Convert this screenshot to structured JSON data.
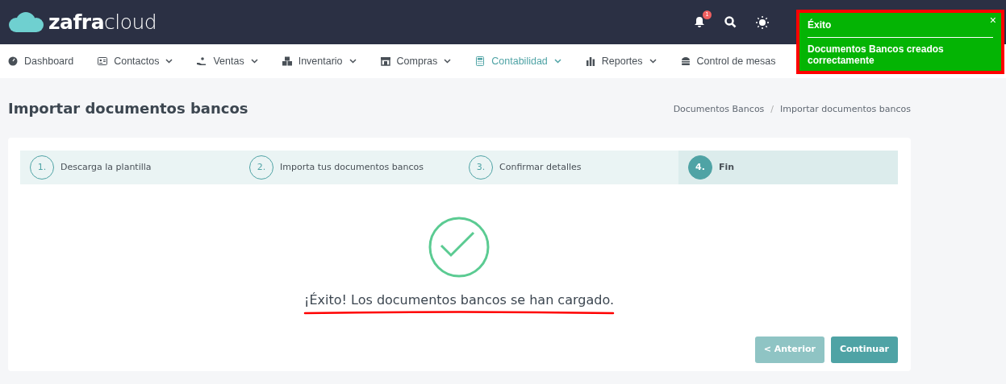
{
  "logo": {
    "brand_bold": "zafra",
    "brand_light": "cloud"
  },
  "header": {
    "notification_count": "1"
  },
  "nav": [
    {
      "label": "Dashboard",
      "has_dropdown": false,
      "selected": false
    },
    {
      "label": "Contactos",
      "has_dropdown": true,
      "selected": false
    },
    {
      "label": "Ventas",
      "has_dropdown": true,
      "selected": false
    },
    {
      "label": "Inventario",
      "has_dropdown": true,
      "selected": false
    },
    {
      "label": "Compras",
      "has_dropdown": true,
      "selected": false
    },
    {
      "label": "Contabilidad",
      "has_dropdown": true,
      "selected": true
    },
    {
      "label": "Reportes",
      "has_dropdown": true,
      "selected": false
    },
    {
      "label": "Control de mesas",
      "has_dropdown": false,
      "selected": false
    }
  ],
  "page_title": "Importar documentos bancos",
  "breadcrumb": [
    "Documentos Bancos",
    "Importar documentos bancos"
  ],
  "breadcrumb_separator": "/",
  "steps": [
    {
      "number": "1.",
      "label": "Descarga la plantilla",
      "selected": false
    },
    {
      "number": "2.",
      "label": "Importa tus documentos bancos",
      "selected": false
    },
    {
      "number": "3.",
      "label": "Confirmar detalles",
      "selected": false
    },
    {
      "number": "4.",
      "label": "Fin",
      "selected": true
    }
  ],
  "message": "¡Éxito! Los documentos bancos se han cargado.",
  "buttons": [
    {
      "label": "< Anterior",
      "disabled": true
    },
    {
      "label": "Continuar",
      "disabled": false
    }
  ],
  "toast": {
    "title": "Éxito",
    "close": "×",
    "body": "Documentos Bancos creados correctamente"
  }
}
